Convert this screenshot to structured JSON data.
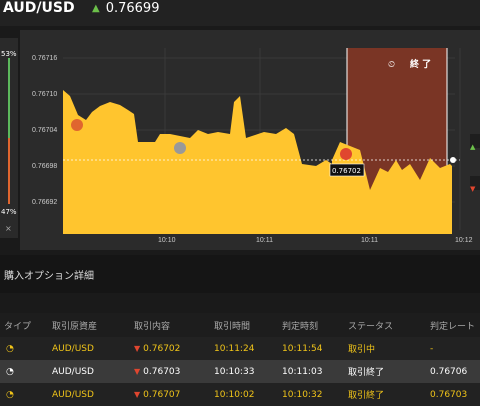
{
  "header": {
    "pair": "AUD/USD",
    "price": "0.76699"
  },
  "gauge": {
    "up_pct": "53%",
    "down_pct": "47%",
    "close": "×"
  },
  "chart": {
    "y_ticks": [
      "0.76716",
      "0.76710",
      "0.76704",
      "0.76698",
      "0.76692"
    ],
    "x_ticks": [
      "10:10",
      "10:11",
      "10:11",
      "10:12"
    ],
    "end_label": "終 了",
    "price_label": "0.76702"
  },
  "section_title": "購入オプション詳細",
  "table": {
    "headers": [
      "タイプ",
      "取引原資産",
      "取引内容",
      "取引時間",
      "判定時刻",
      "ステータス",
      "判定レート"
    ],
    "rows": [
      [
        "",
        "AUD/USD",
        "0.76702",
        "10:11:24",
        "10:11:54",
        "取引中",
        "-"
      ],
      [
        "",
        "AUD/USD",
        "0.76703",
        "10:10:33",
        "10:11:03",
        "取引終了",
        "0.76706"
      ],
      [
        "",
        "AUD/USD",
        "0.76707",
        "10:10:02",
        "10:10:32",
        "取引終了",
        "0.76703"
      ]
    ]
  }
}
